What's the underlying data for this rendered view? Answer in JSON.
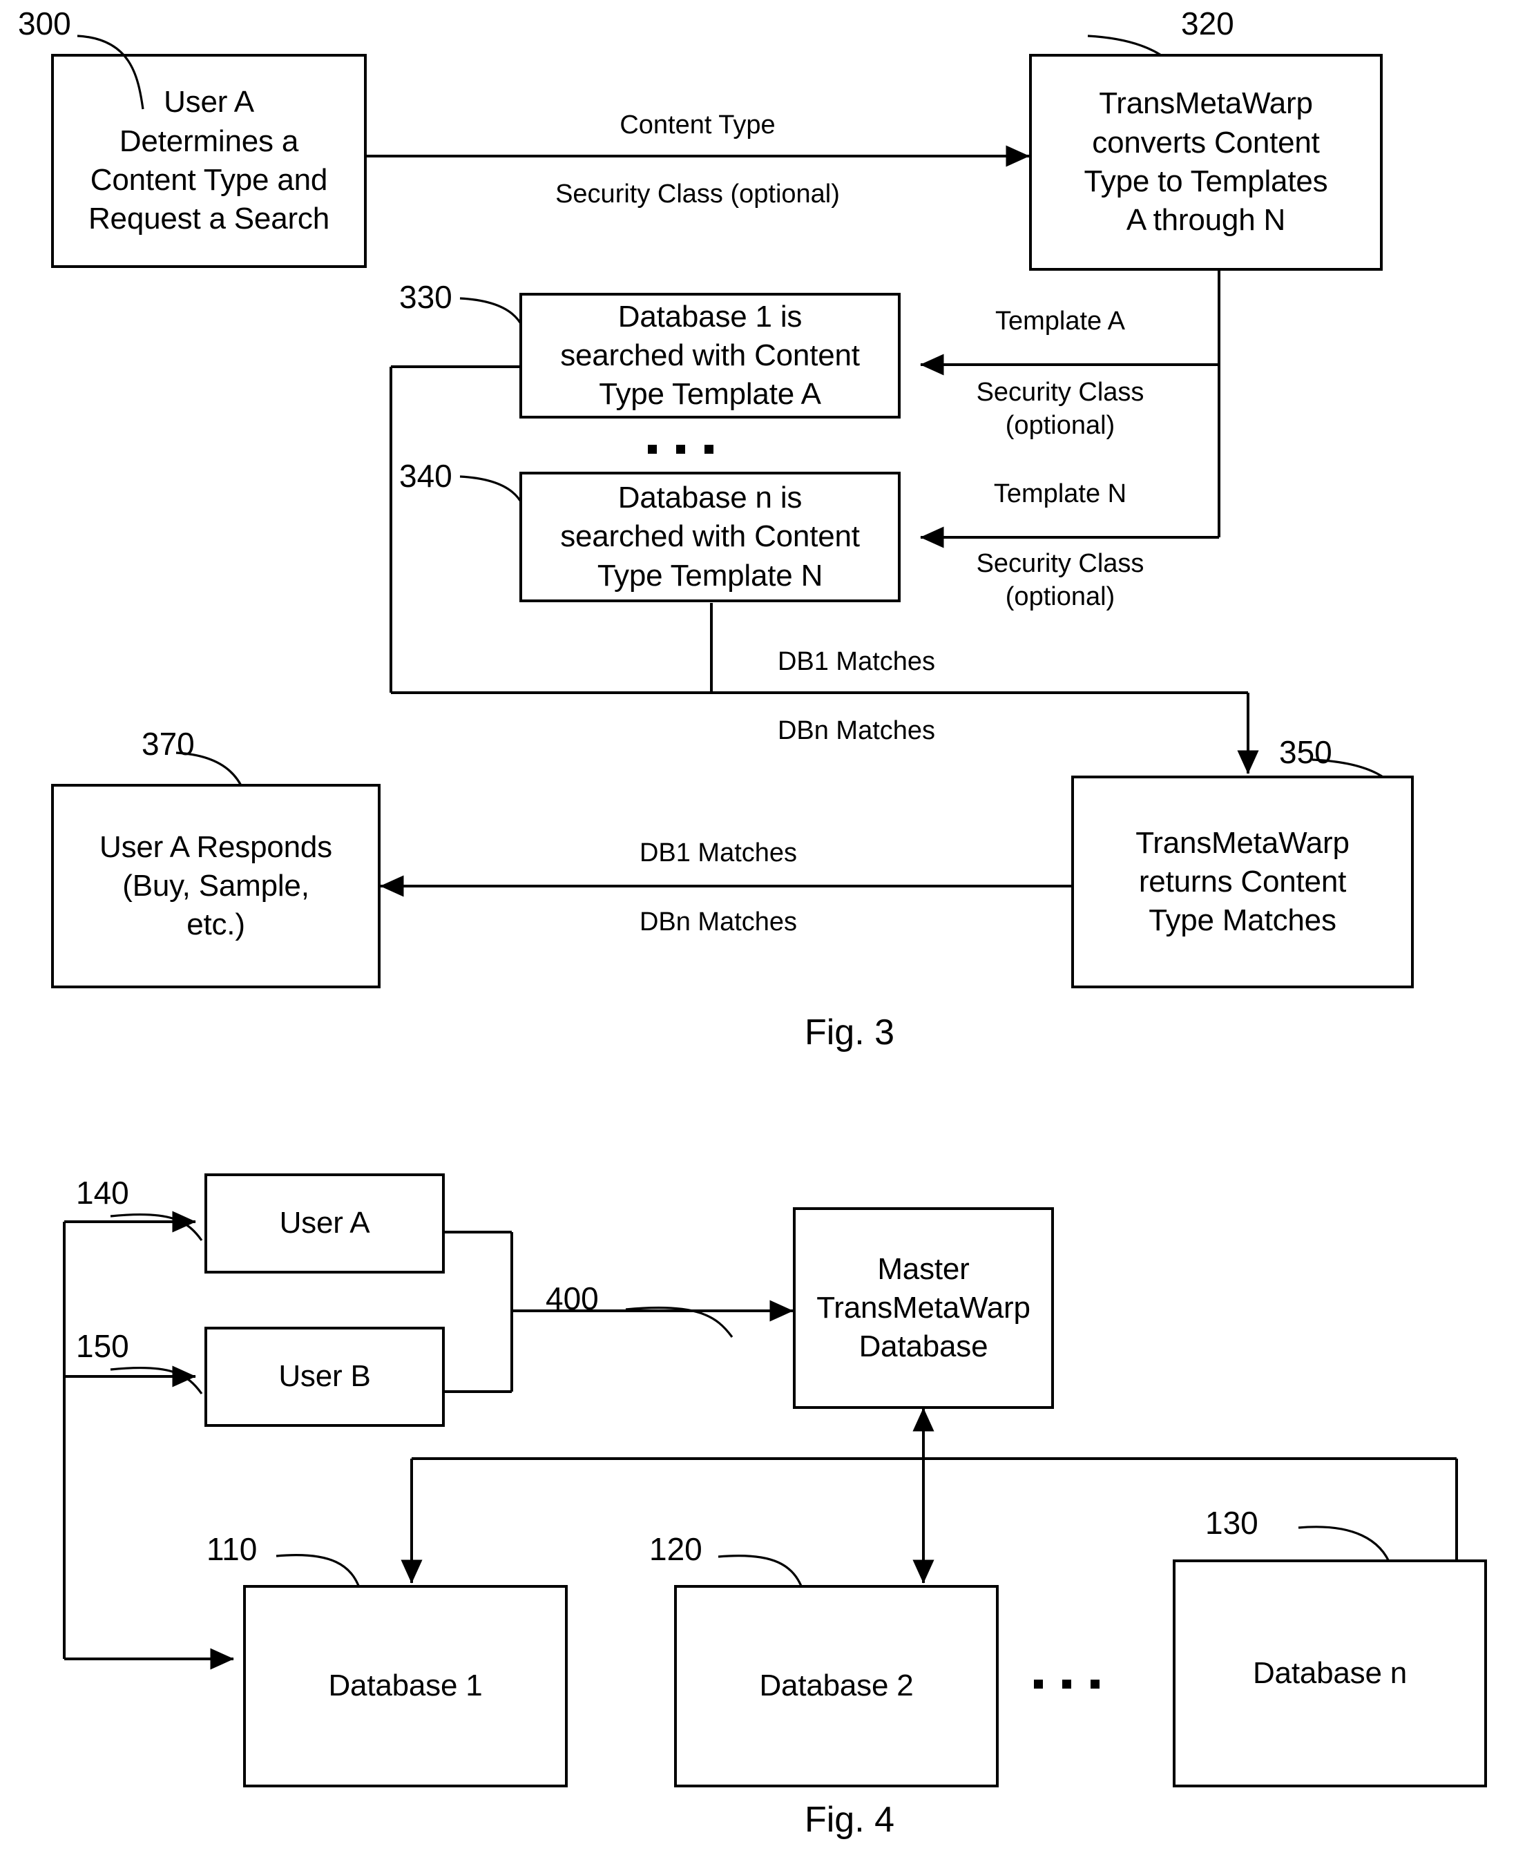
{
  "figures": [
    {
      "id": "fig3",
      "caption": "Fig. 3",
      "boxes": [
        {
          "ref": "300",
          "text": "User A\nDetermines a\nContent Type and\nRequest a Search"
        },
        {
          "ref": "320",
          "text": "TransMetaWarp\nconverts Content\nType to Templates\nA through N"
        },
        {
          "ref": "330",
          "text": "Database 1 is\nsearched with Content\nType Template A"
        },
        {
          "ref": "340",
          "text": "Database n is\nsearched with Content\nType Template N"
        },
        {
          "ref": "350",
          "text": "TransMetaWarp\nreturns Content\nType Matches"
        },
        {
          "ref": "370",
          "text": "User A Responds\n(Buy, Sample,\netc.)"
        }
      ],
      "edge_labels": [
        "Content Type",
        "Security Class (optional)",
        "Template A",
        "Security Class\n(optional)",
        "Template N",
        "Security Class\n(optional)",
        "DB1 Matches",
        "DBn Matches",
        "DB1 Matches",
        "DBn Matches"
      ]
    },
    {
      "id": "fig4",
      "caption": "Fig. 4",
      "boxes": [
        {
          "ref": "140",
          "text": "User A"
        },
        {
          "ref": "150",
          "text": "User B"
        },
        {
          "ref": "400",
          "text": "Master\nTransMetaWarp\nDatabase"
        },
        {
          "ref": "110",
          "text": "Database 1"
        },
        {
          "ref": "120",
          "text": "Database 2"
        },
        {
          "ref": "130",
          "text": "Database n"
        }
      ],
      "edge_labels": []
    }
  ]
}
